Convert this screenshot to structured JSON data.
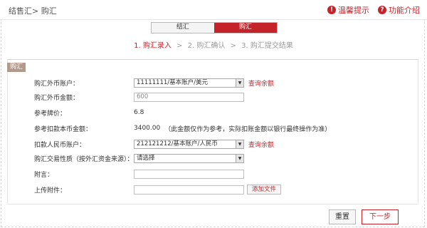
{
  "header": {
    "breadcrumb": "结售汇> 购汇",
    "tips_label": "温馨提示",
    "intro_label": "功能介绍"
  },
  "tabs": [
    {
      "label": "结汇",
      "active": false
    },
    {
      "label": "购汇",
      "active": true
    }
  ],
  "steps": [
    {
      "label": "1. 购汇录入",
      "current": true
    },
    {
      "label": "2. 购汇确认",
      "current": false
    },
    {
      "label": "3. 购汇提交结果",
      "current": false
    }
  ],
  "panel": {
    "tag": "购汇"
  },
  "form": {
    "fx_account": {
      "label": "购汇外币账户：",
      "value": "11111111/基本账户/美元",
      "link": "查询余额"
    },
    "fx_amount": {
      "label": "购汇外币金额：",
      "placeholder": "600"
    },
    "ref_rate": {
      "label": "参考牌价：",
      "value": "6.8"
    },
    "ref_rmb": {
      "label": "参考扣款本币金额：",
      "value": "3400.00",
      "note": "（此金额仅作为参考，实际扣账金额以银行最终操作为准）"
    },
    "rmb_account": {
      "label": "扣款人民币账户：",
      "value": "212121212/基本账户/人民币",
      "link": "查询余额"
    },
    "tx_nature": {
      "label": "购汇交易性质（按外汇资金来源）：",
      "value": "请选择"
    },
    "remark": {
      "label": "附言：",
      "placeholder": ""
    },
    "attachment": {
      "label": "上传附件：",
      "button": "添加文件"
    }
  },
  "footer": {
    "reset_label": "重置",
    "next_label": "下一步"
  },
  "colors": {
    "accent": "#c4232a",
    "tag_bg": "#b2998a"
  }
}
